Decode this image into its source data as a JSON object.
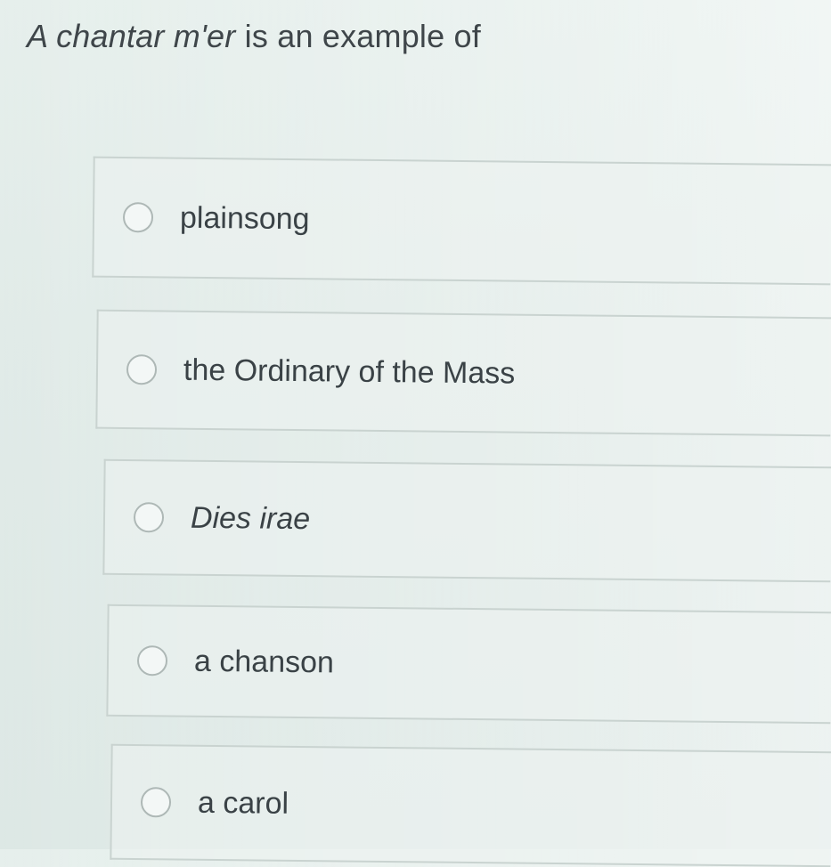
{
  "question": {
    "prefix": "A chantar m'er",
    "suffix": " is an example of"
  },
  "options": [
    {
      "label": "plainsong",
      "italic": false,
      "selected": false
    },
    {
      "label": "the Ordinary of the Mass",
      "italic": false,
      "selected": false
    },
    {
      "label": "Dies irae",
      "italic": true,
      "selected": false
    },
    {
      "label": "a chanson",
      "italic": false,
      "selected": false
    },
    {
      "label": "a carol",
      "italic": false,
      "selected": false
    }
  ]
}
